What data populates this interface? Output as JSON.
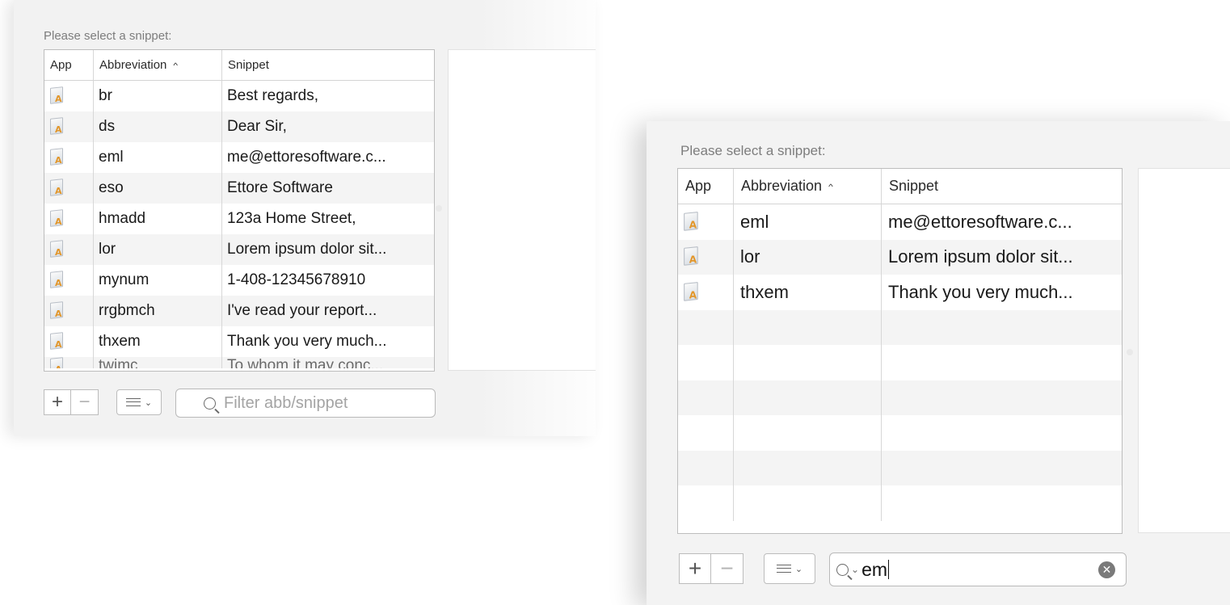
{
  "panel_a": {
    "prompt": "Please select a snippet:",
    "columns": {
      "app": "App",
      "abbreviation": "Abbreviation",
      "snippet": "Snippet"
    },
    "sort_indicator": "^",
    "rows": [
      {
        "abbreviation": "br",
        "snippet": "Best regards,"
      },
      {
        "abbreviation": "ds",
        "snippet": "Dear Sir,"
      },
      {
        "abbreviation": "eml",
        "snippet": "me@ettoresoftware.c..."
      },
      {
        "abbreviation": "eso",
        "snippet": "Ettore Software"
      },
      {
        "abbreviation": "hmadd",
        "snippet": "123a Home Street,"
      },
      {
        "abbreviation": "lor",
        "snippet": "Lorem ipsum dolor sit..."
      },
      {
        "abbreviation": "mynum",
        "snippet": "1-408-12345678910"
      },
      {
        "abbreviation": "rrgbmch",
        "snippet": "I've read your report..."
      },
      {
        "abbreviation": "thxem",
        "snippet": "Thank you very much..."
      },
      {
        "abbreviation": "twimc",
        "snippet": "To whom it may conc..."
      }
    ],
    "toolbar": {
      "add_label": "+",
      "remove_label": "−",
      "menu_chevron": "⌄",
      "search_placeholder": "Filter abb/snippet"
    }
  },
  "panel_b": {
    "prompt": "Please select a snippet:",
    "columns": {
      "app": "App",
      "abbreviation": "Abbreviation",
      "snippet": "Snippet"
    },
    "sort_indicator": "^",
    "rows": [
      {
        "abbreviation": "eml",
        "snippet": "me@ettoresoftware.c..."
      },
      {
        "abbreviation": "lor",
        "snippet": "Lorem ipsum dolor sit..."
      },
      {
        "abbreviation": "thxem",
        "snippet": "Thank you very much..."
      },
      {
        "abbreviation": "",
        "snippet": ""
      },
      {
        "abbreviation": "",
        "snippet": ""
      },
      {
        "abbreviation": "",
        "snippet": ""
      },
      {
        "abbreviation": "",
        "snippet": ""
      },
      {
        "abbreviation": "",
        "snippet": ""
      },
      {
        "abbreviation": "",
        "snippet": ""
      }
    ],
    "toolbar": {
      "add_label": "+",
      "remove_label": "−",
      "menu_chevron": "⌄",
      "search_caret": "⌄",
      "search_value": "em",
      "clear_label": "✕"
    }
  },
  "icons": {
    "app_icon": "generic-application-icon",
    "app_icon_glyph": "A",
    "search": "search-icon",
    "clear": "clear-icon",
    "menu": "list-menu-icon"
  }
}
